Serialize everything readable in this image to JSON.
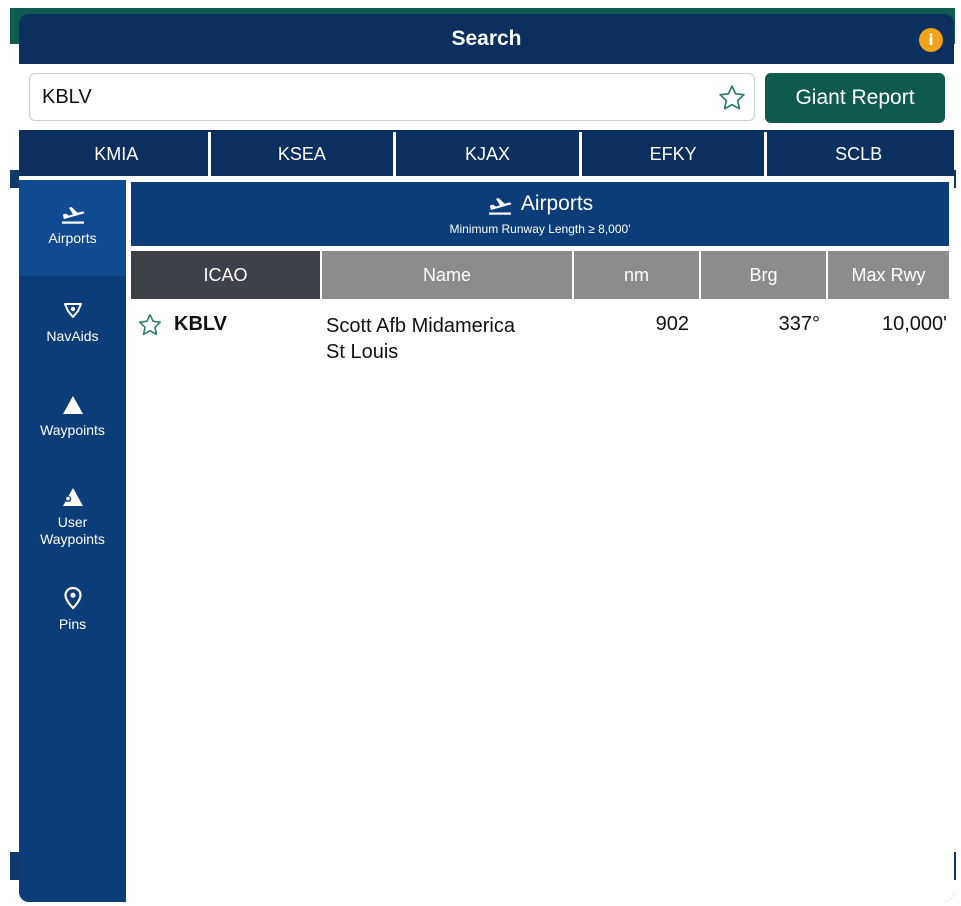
{
  "dialog": {
    "title": "Search",
    "info_icon": "info-icon"
  },
  "search": {
    "value": "KBLV",
    "placeholder": "",
    "favorite_icon": "star-outline-icon",
    "report_button": "Giant Report"
  },
  "recent_tabs": [
    "KMIA",
    "KSEA",
    "KJAX",
    "EFKY",
    "SCLB"
  ],
  "sidebar": {
    "items": [
      {
        "label": "Airports",
        "icon": "airplane-takeoff-icon",
        "active": true
      },
      {
        "label": "NavAids",
        "icon": "navaid-icon",
        "active": false
      },
      {
        "label": "Waypoints",
        "icon": "triangle-icon",
        "active": false
      },
      {
        "label": "User\nWaypoints",
        "icon": "user-waypoint-icon",
        "active": false
      },
      {
        "label": "Pins",
        "icon": "map-pin-icon",
        "active": false
      }
    ]
  },
  "category": {
    "title": "Airports",
    "icon": "airplane-takeoff-icon",
    "subtitle": "Minimum Runway Length ≥ 8,000'"
  },
  "table": {
    "columns": [
      "ICAO",
      "Name",
      "nm",
      "Brg",
      "Max Rwy"
    ],
    "sorted_column": "ICAO",
    "rows": [
      {
        "icao": "KBLV",
        "name_line1": "Scott Afb Midamerica",
        "name_line2": "St Louis",
        "nm": "902",
        "brg": "337°",
        "max_rwy": "10,000'",
        "favorite": false
      }
    ]
  },
  "colors": {
    "dialog_bg": "#0b2f5e",
    "accent_green": "#0e5a4d",
    "info_orange": "#f0a21b",
    "header_active": "#3e4147",
    "header_inactive": "#8c8c8c"
  }
}
